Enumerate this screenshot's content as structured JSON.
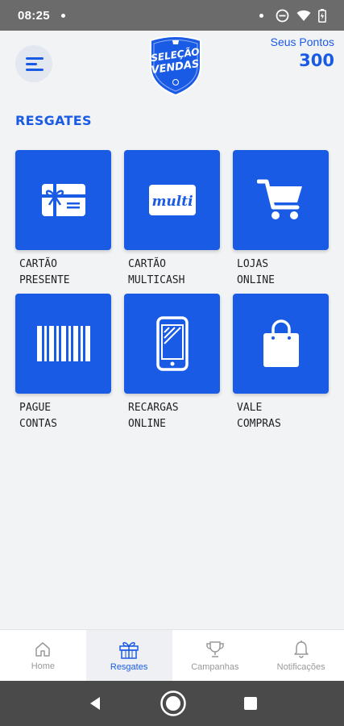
{
  "status_bar": {
    "time": "08:25"
  },
  "header": {
    "logo_line1": "SELEÇÃO",
    "logo_line2": "VENDAS",
    "points_label": "Seus Pontos",
    "points_value": "300"
  },
  "section": {
    "title": "RESGATES"
  },
  "tiles": [
    {
      "label": "CARTÃO\nPRESENTE",
      "icon": "gift-card-icon"
    },
    {
      "label": "CARTÃO\nMULTICASH",
      "icon": "multi-card-icon",
      "icon_text": "multi"
    },
    {
      "label": "LOJAS\nONLINE",
      "icon": "shopping-cart-icon"
    },
    {
      "label": "PAGUE\nCONTAS",
      "icon": "barcode-icon"
    },
    {
      "label": "RECARGAS\nONLINE",
      "icon": "smartphone-icon"
    },
    {
      "label": "VALE\nCOMPRAS",
      "icon": "shopping-bag-icon"
    }
  ],
  "bottom_nav": [
    {
      "label": "Home",
      "icon": "home-icon",
      "active": false
    },
    {
      "label": "Resgates",
      "icon": "gift-icon",
      "active": true
    },
    {
      "label": "Campanhas",
      "icon": "trophy-icon",
      "active": false
    },
    {
      "label": "Notificações",
      "icon": "bell-icon",
      "active": false
    }
  ],
  "colors": {
    "accent": "#1a5be6",
    "background": "#f2f3f5",
    "status_bar": "#6b6b6b",
    "system_nav": "#4a4a4a"
  }
}
